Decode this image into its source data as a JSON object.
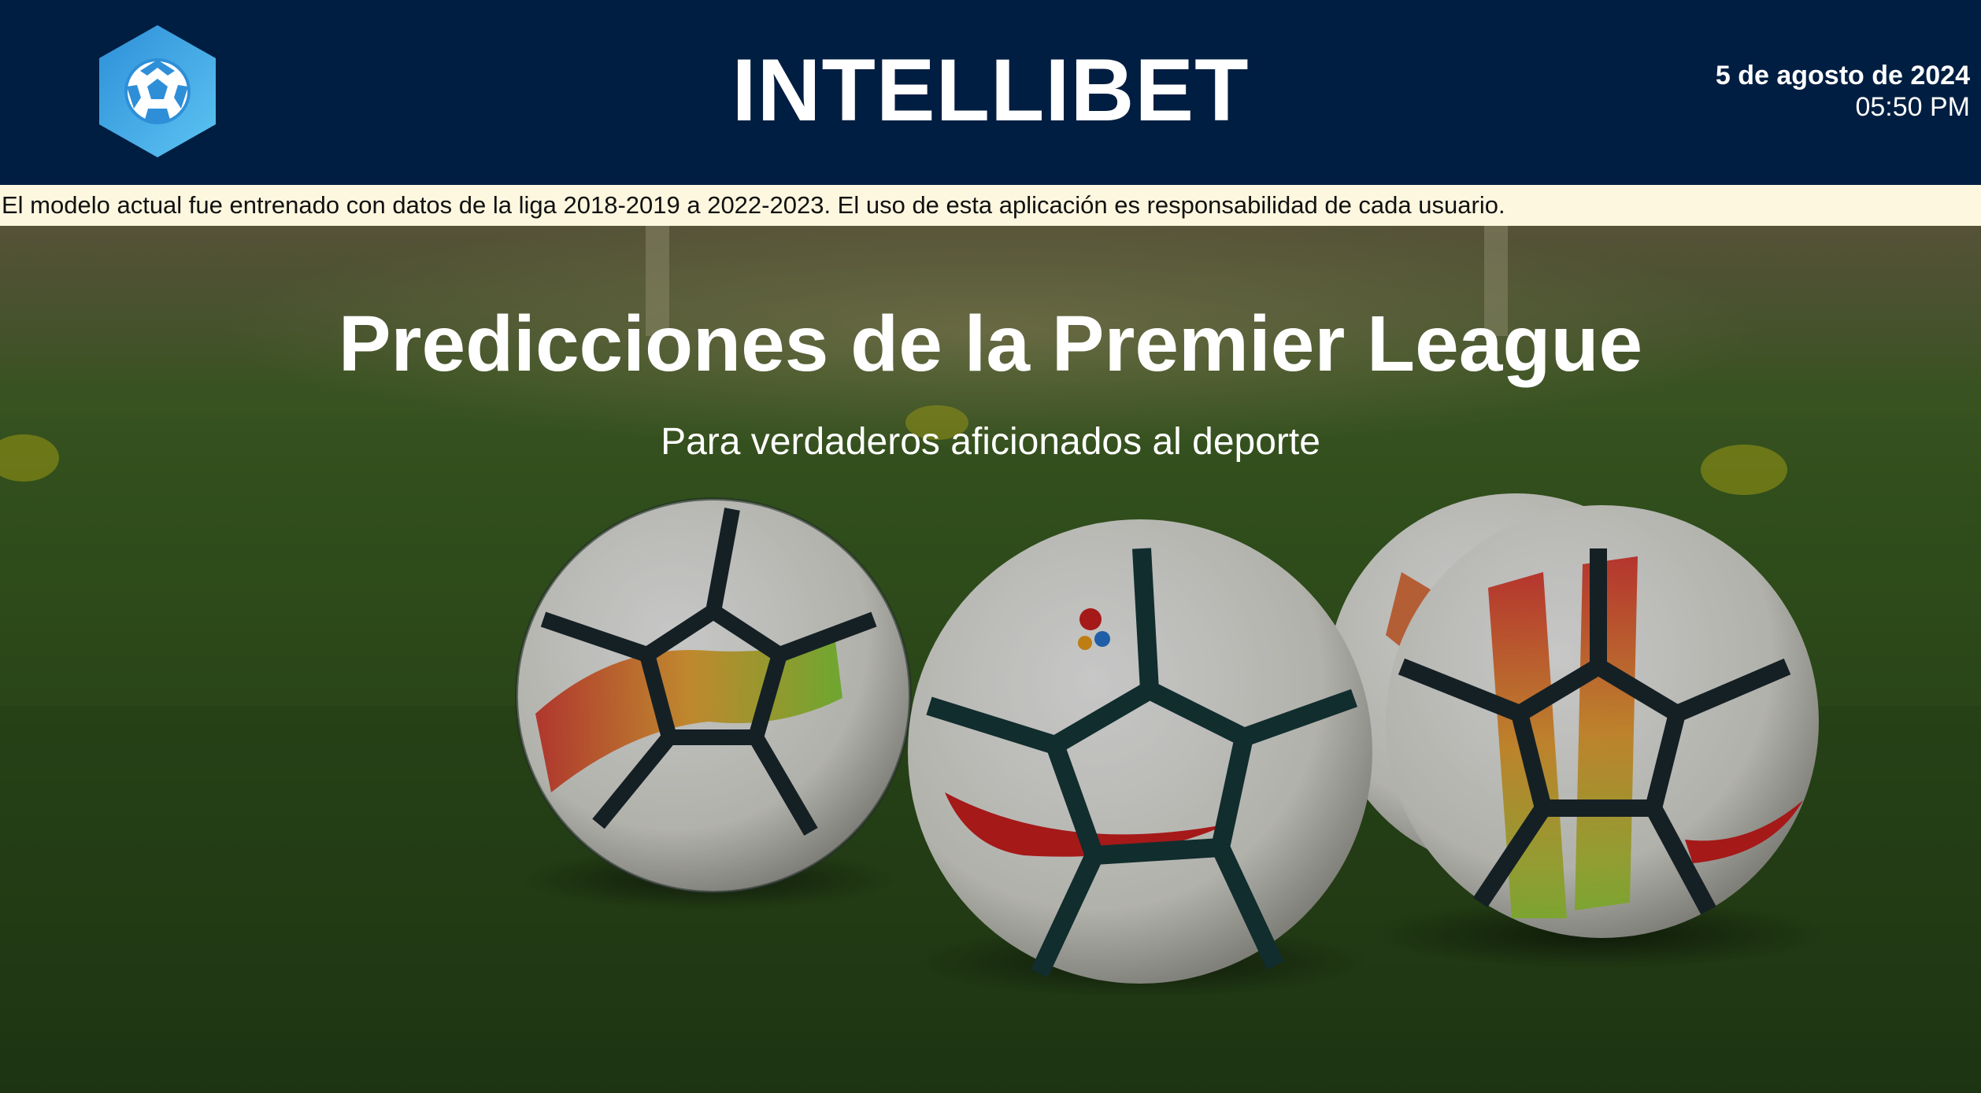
{
  "header": {
    "brand": "INTELLIBET",
    "logo_icon": "soccer-ball-hexagon-icon",
    "date": "5 de agosto de 2024",
    "time": "05:50 PM",
    "background_color": "#001e41"
  },
  "disclaimer": {
    "text": "El modelo actual fue entrenado con datos de la liga 2018-2019 a 2022-2023. El uso de esta aplicación es responsabilidad de cada usuario.",
    "background_color": "#fdf7df"
  },
  "hero": {
    "title": "Predicciones de la Premier League",
    "subtitle": "Para verdaderos aficionados al deporte",
    "image": "soccer-balls-on-grass-image"
  }
}
